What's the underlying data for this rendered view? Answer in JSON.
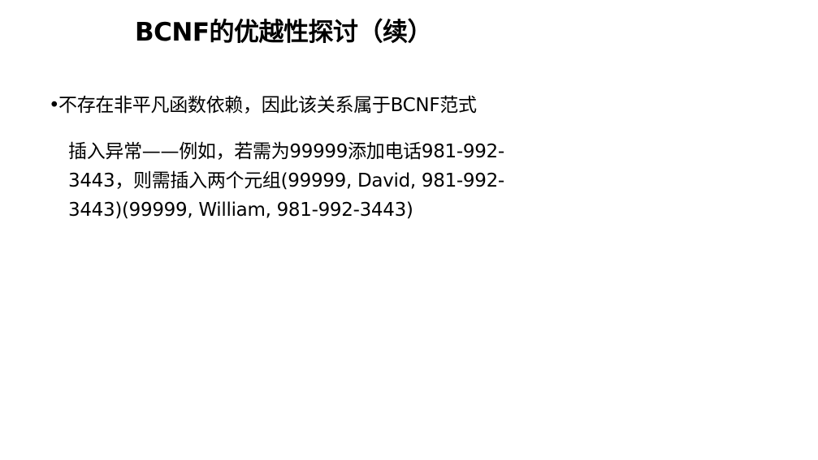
{
  "slide": {
    "title": "BCNF的优越性探讨（续）",
    "bullet": {
      "marker": "•",
      "text": "不存在非平凡函数依赖，因此该关系属于BCNF范式"
    },
    "paragraph": {
      "lines": [
        "插入异常——例如，若需为99999添加电话981-992-",
        "3443，则需插入两个元组(99999, David, 981-992-",
        "3443)(99999, William, 981-992-3443)"
      ]
    }
  }
}
